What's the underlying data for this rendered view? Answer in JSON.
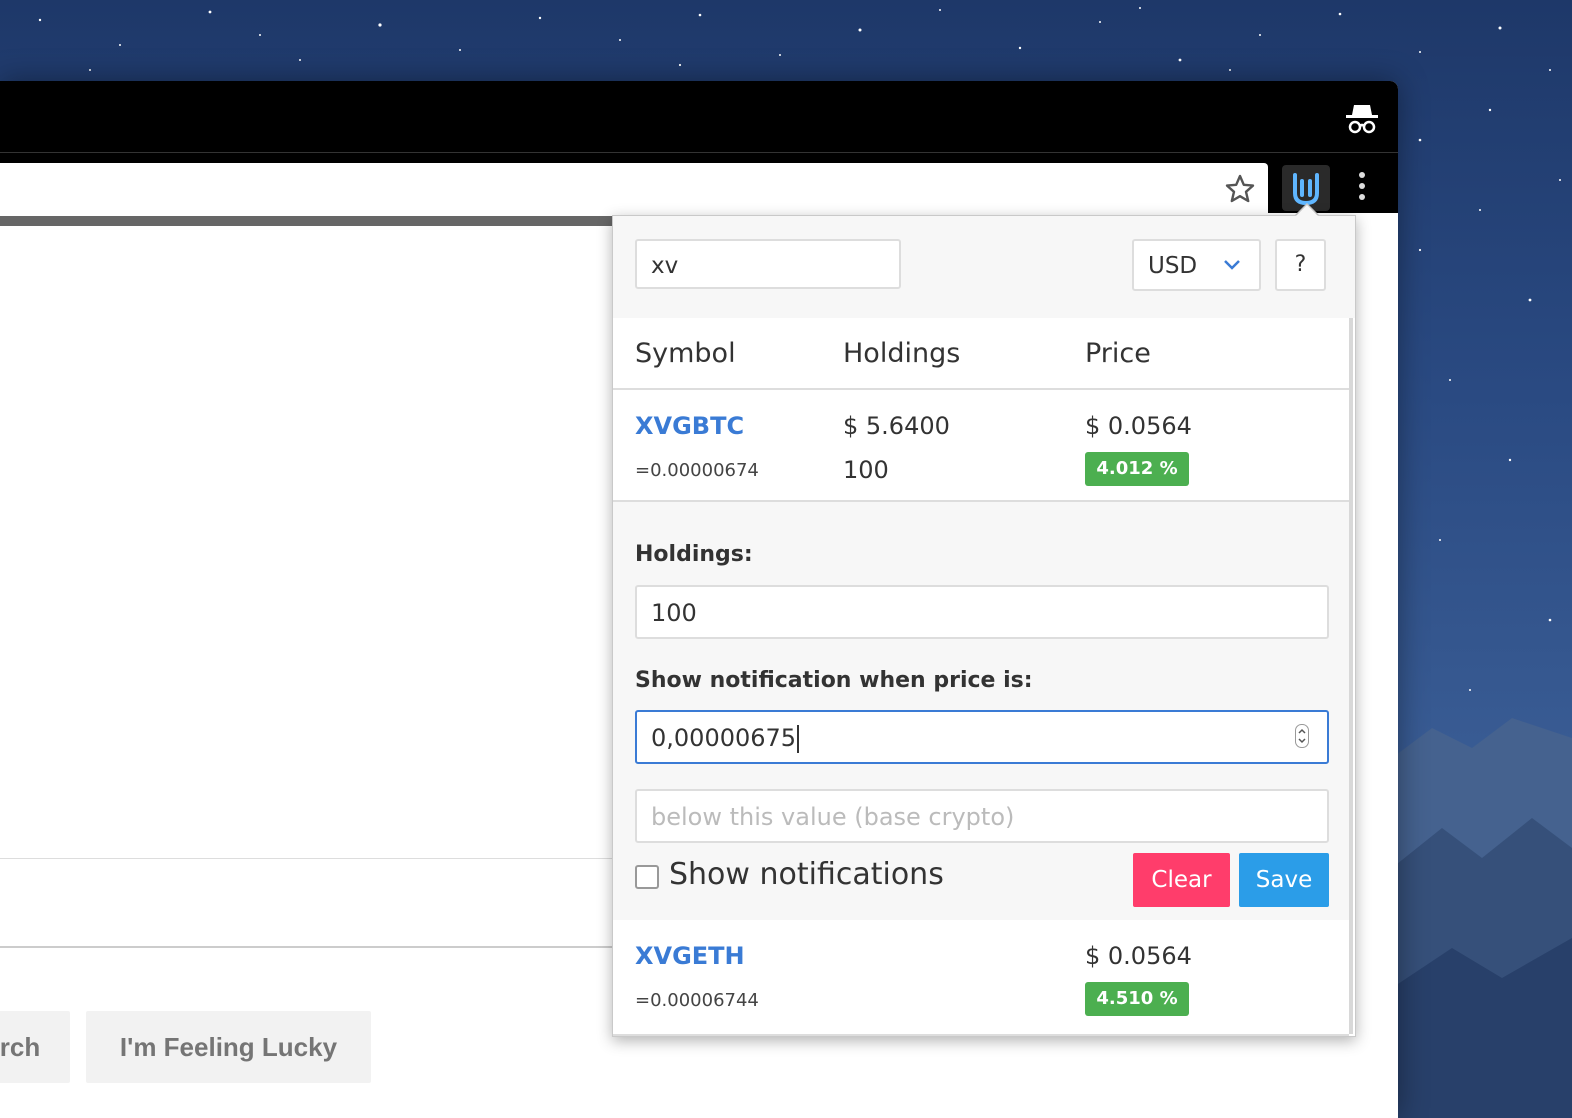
{
  "popup": {
    "search": {
      "value": "xv"
    },
    "currency": {
      "selected": "USD"
    },
    "help_label": "?",
    "table": {
      "headers": [
        "Symbol",
        "Holdings",
        "Price"
      ],
      "rows": [
        {
          "symbol": "XVGBTC",
          "rate": "=0.00000674",
          "holdings_value": "$ 5.6400",
          "holdings_amount": "100",
          "price": "$ 0.0564",
          "change": "4.012 %"
        },
        {
          "symbol": "XVGETH",
          "rate": "=0.00006744",
          "holdings_value": "",
          "holdings_amount": "",
          "price": "$ 0.0564",
          "change": "4.510 %"
        }
      ]
    },
    "editor": {
      "holdings_label": "Holdings:",
      "holdings_value": "100",
      "notify_label": "Show notification when price is:",
      "above_value": "0,00000675",
      "below_placeholder": "below this value (base crypto)",
      "show_notifications_label": "Show notifications",
      "show_notifications_checked": false,
      "clear_label": "Clear",
      "save_label": "Save"
    },
    "colors": {
      "symbol": "#3a7bd5",
      "badge_up": "#4caf50",
      "clear": "#ff3d6b",
      "save": "#2b9de8"
    }
  },
  "page": {
    "search_button": "rch",
    "lucky_button": "I'm Feeling Lucky"
  },
  "icons": [
    "incognito-icon",
    "bookmark-star-icon",
    "extension-crypto-icon",
    "menu-dots-icon",
    "chevron-down-icon",
    "spinner-icon"
  ]
}
